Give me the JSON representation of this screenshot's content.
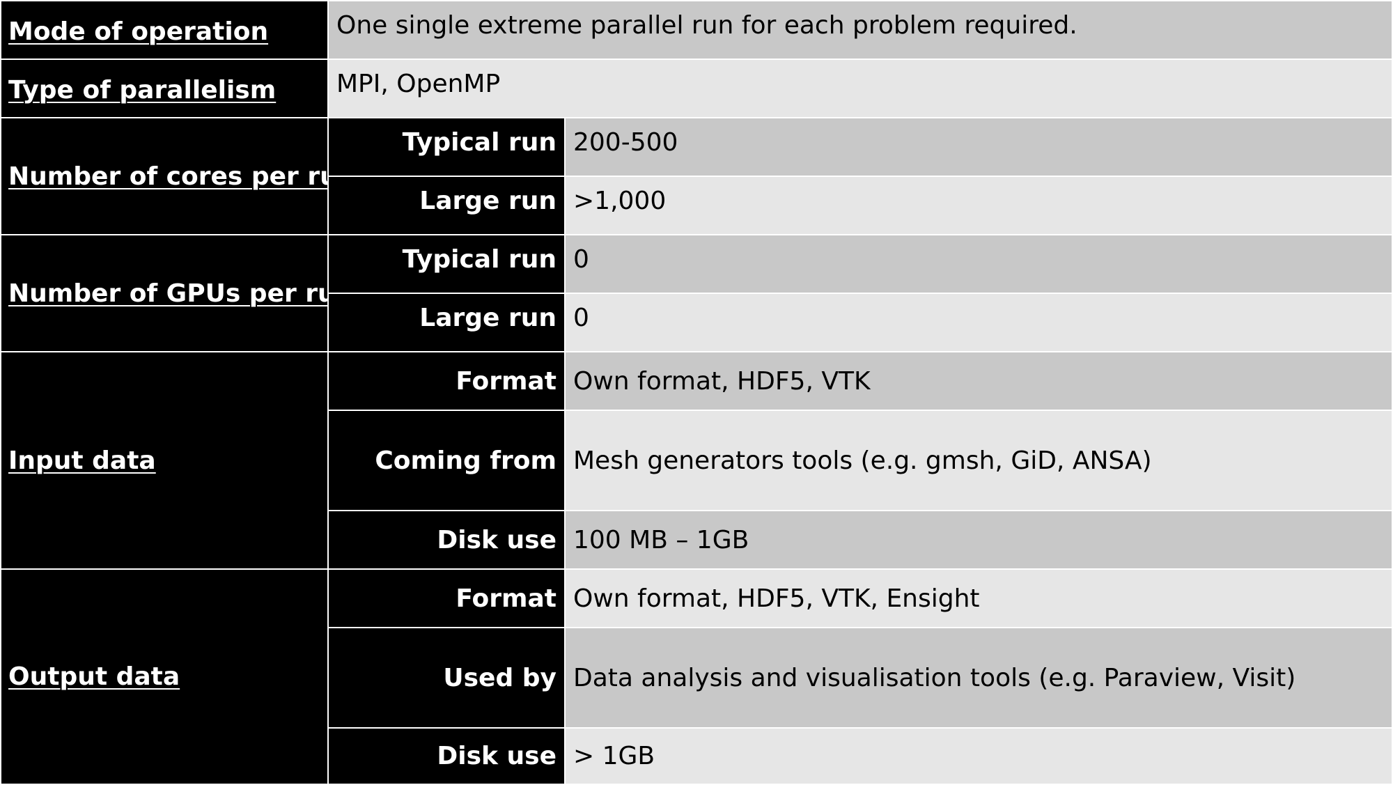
{
  "rows": {
    "mode": {
      "label": "Mode of operation",
      "value": "One single extreme parallel run for each problem required."
    },
    "parallelism": {
      "label": "Type of parallelism",
      "value": "MPI, OpenMP"
    },
    "cores": {
      "label": "Number of cores per run",
      "typical_label": "Typical run",
      "typical_value": "200-500",
      "large_label": "Large run",
      "large_value": ">1,000"
    },
    "gpus": {
      "label": "Number of GPUs per run",
      "typical_label": "Typical run",
      "typical_value": "0",
      "large_label": "Large run",
      "large_value": "0"
    },
    "input": {
      "label": "Input data",
      "format_label": "Format",
      "format_value": "Own format, HDF5, VTK",
      "source_label": "Coming from",
      "source_value": "Mesh generators tools (e.g. gmsh, GiD, ANSA)",
      "disk_label": "Disk use",
      "disk_value": "100 MB – 1GB"
    },
    "output": {
      "label": "Output data",
      "format_label": "Format",
      "format_value": "Own format, HDF5, VTK, Ensight",
      "usedby_label": "Used by",
      "usedby_value": "Data analysis and visualisation tools (e.g. Paraview, Visit)",
      "disk_label": "Disk use",
      "disk_value": "> 1GB"
    }
  },
  "colors": {
    "header_bg": "#000000",
    "header_text": "#ffffff",
    "row_dark": "#c8c8c8",
    "row_light": "#e6e6e6",
    "value_text": "#000000"
  }
}
